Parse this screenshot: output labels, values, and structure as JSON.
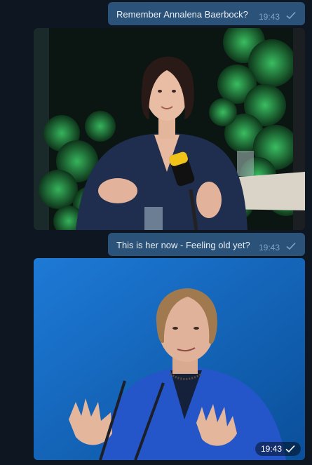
{
  "messages": [
    {
      "type": "text",
      "text": "Remember Annalena Baerbock?",
      "time": "19:43",
      "status_icon": "check-icon"
    },
    {
      "type": "photo",
      "subject": "woman-speaking-at-microphone",
      "time": ""
    },
    {
      "type": "text",
      "text": "This is her now - Feeling old yet?",
      "time": "19:43",
      "status_icon": "check-icon"
    },
    {
      "type": "photo",
      "subject": "woman-speaking-in-blue-jacket",
      "time": "19:43",
      "status_icon": "check-icon"
    }
  ],
  "colors": {
    "background": "#0e1621",
    "outgoing_bubble": "#2b5278",
    "time": "#7fa3c8"
  }
}
